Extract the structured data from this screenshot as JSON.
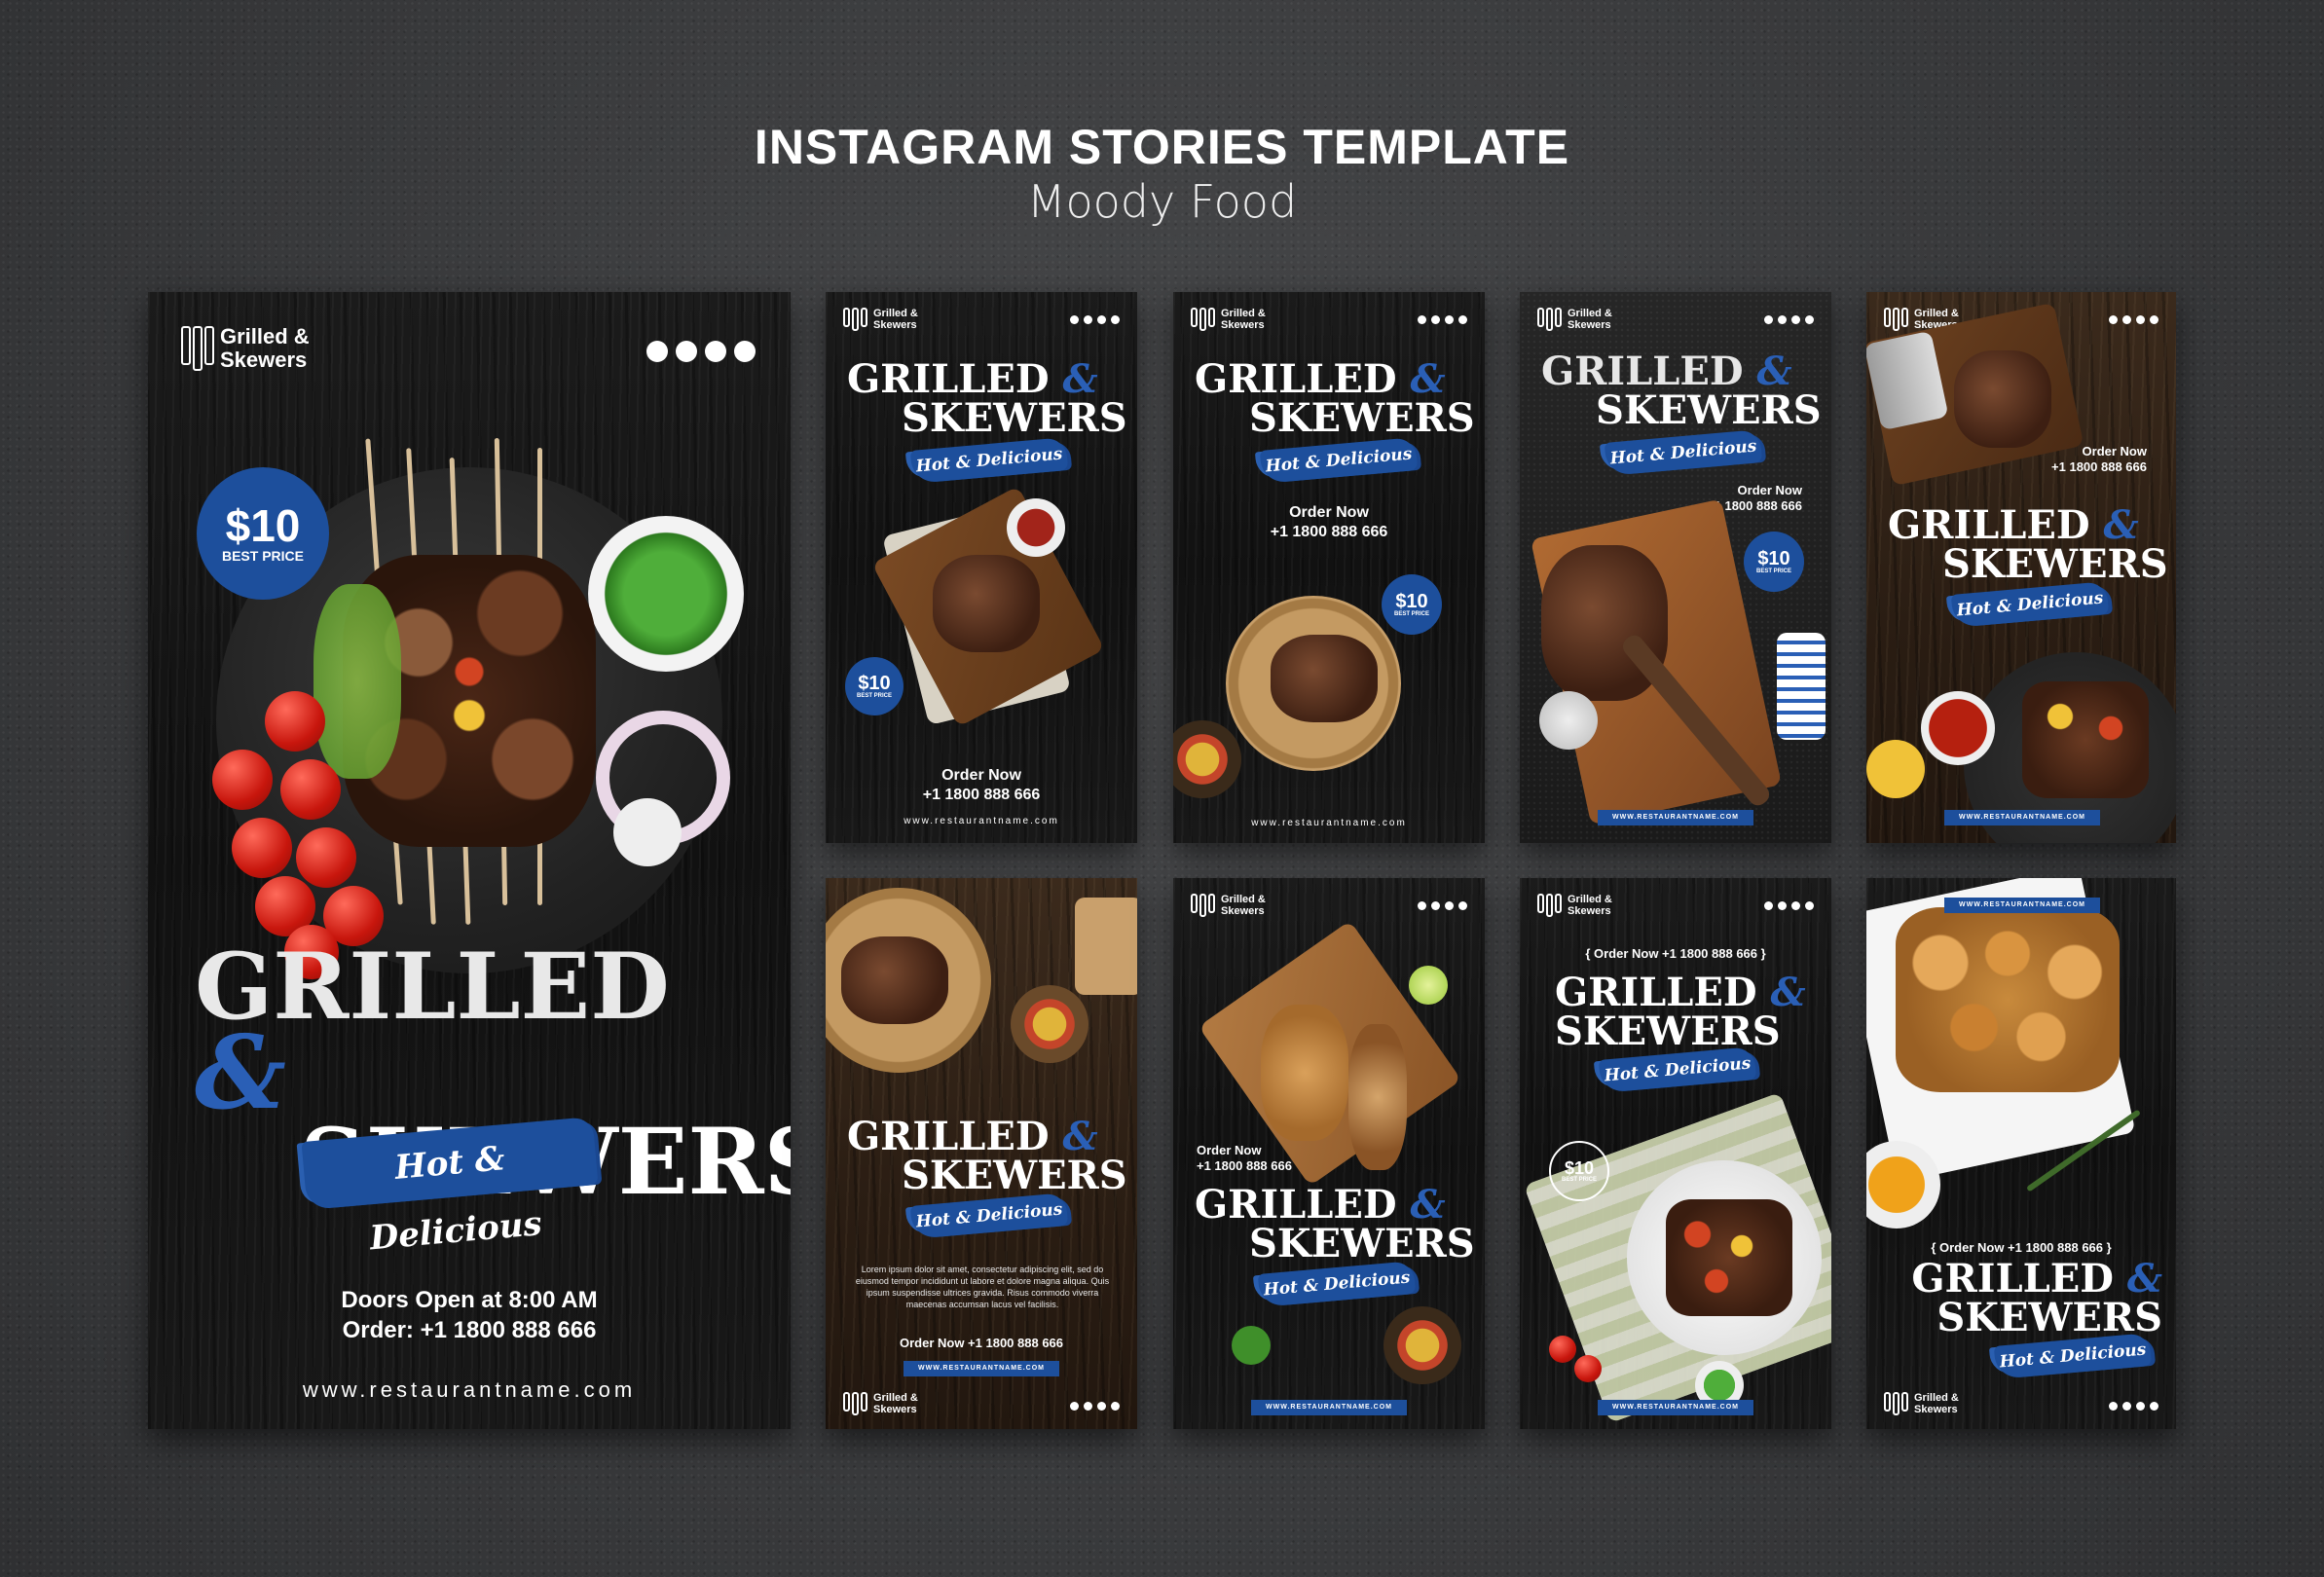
{
  "header": {
    "title": "INSTAGRAM STORIES TEMPLATE",
    "subtitle": "Moody Food"
  },
  "brand": {
    "logo_line1": "Grilled &",
    "logo_line2": "Skewers",
    "headline_line1": "GRILLED",
    "amp": "&",
    "headline_line2": "SKEWERS",
    "tagline": "Hot & Delicious",
    "accent_color": "#1d4f9c"
  },
  "icons": [
    "instagram-icon",
    "facebook-icon",
    "twitter-icon",
    "whatsapp-icon"
  ],
  "price": {
    "amount": "$10",
    "label": "BEST PRICE"
  },
  "contact": {
    "doors": "Doors Open at 8:00 AM",
    "order_phone": "Order: +1 1800 888 666",
    "order_now": "Order Now",
    "phone": "+1 1800 888 666",
    "order_now_phone": "Order Now +1 1800 888 666",
    "order_now_phone_bracket": "{ Order Now +1 1800 888 666 }",
    "website": "www.restaurantname.com",
    "website_caps": "WWW.RESTAURANTNAME.COM"
  },
  "lorem": "Lorem ipsum dolor sit amet, consectetur adipiscing elit, sed do eiusmod tempor incididunt ut labore et dolore magna aliqua. Quis ipsum suspendisse ultrices gravida. Risus commodo viverra maecenas accumsan lacus vel facilisis."
}
